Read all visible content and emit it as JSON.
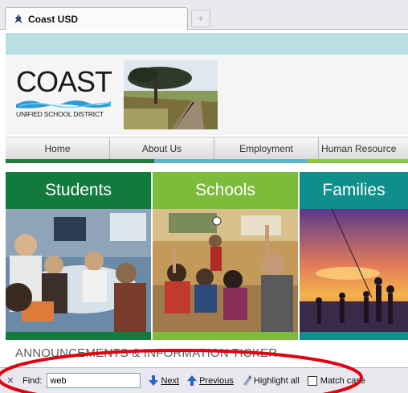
{
  "browser": {
    "tab_title": "Coast USD",
    "new_tab_symbol": "+"
  },
  "logo": {
    "name": "COAST",
    "subtitle": "UNIFIED SCHOOL DISTRICT"
  },
  "nav": {
    "items": [
      "Home",
      "About Us",
      "Employment",
      "Human Resource"
    ]
  },
  "cards": [
    {
      "label": "Students",
      "color": "#137a3e"
    },
    {
      "label": "Schools",
      "color": "#7dbb3a"
    },
    {
      "label": "Families",
      "color": "#0f8f8c"
    }
  ],
  "ticker": {
    "text": "ANNOUNCEMENTS & INFORMATION TICKER"
  },
  "find_bar": {
    "close_symbol": "✕",
    "label": "Find:",
    "query": "web",
    "next_label": "Next",
    "previous_label": "Previous",
    "highlight_label": "Highlight all",
    "match_case_label": "Match case",
    "match_case_checked": false
  },
  "colors": {
    "top_band": "#b9dfe3",
    "stripe_green": "#1f7a3c",
    "stripe_blue": "#5fb7c9",
    "stripe_lime": "#8dc63f",
    "annotation": "#e0000f"
  }
}
